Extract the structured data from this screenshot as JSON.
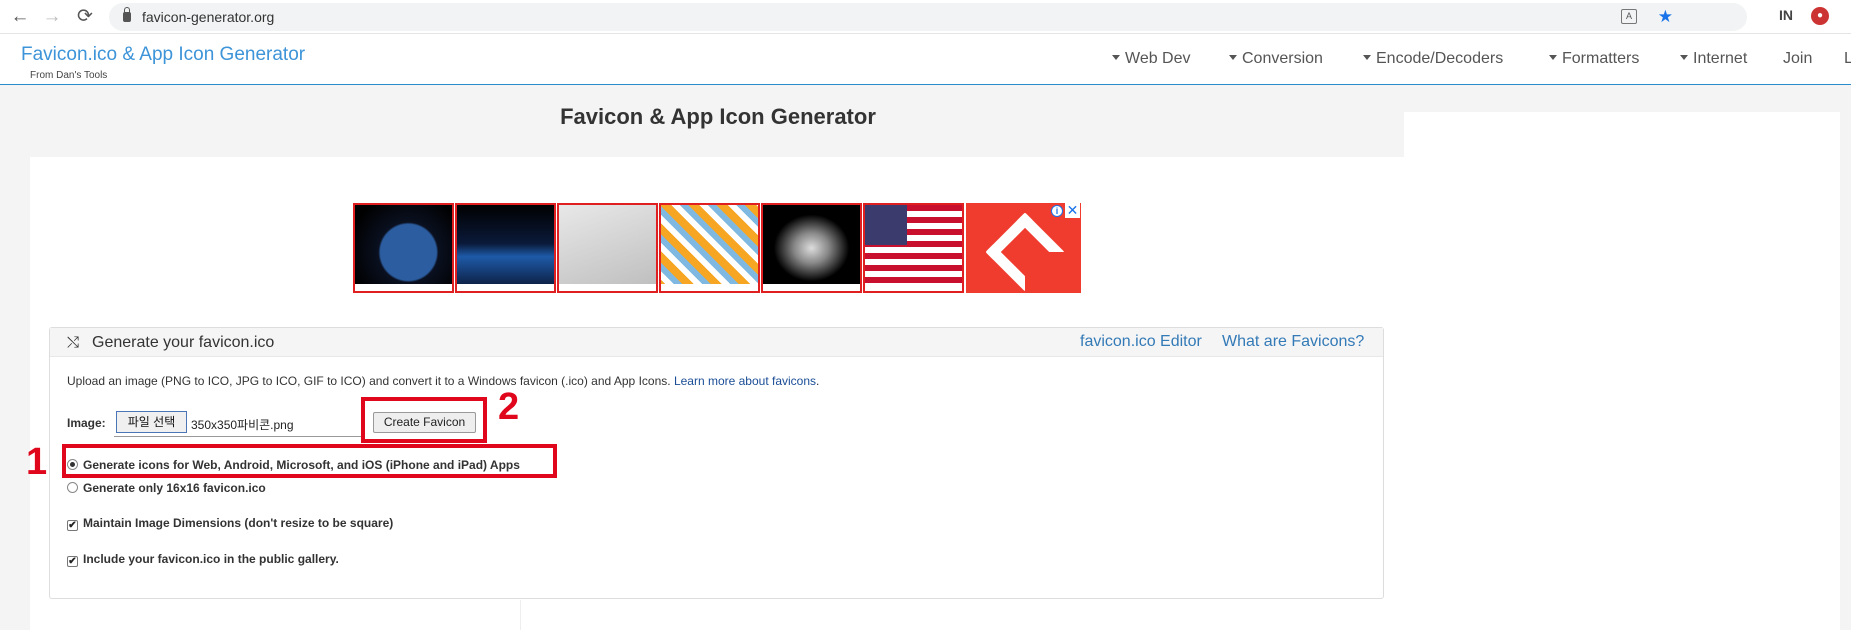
{
  "browser": {
    "url": "favicon-generator.org",
    "back_icon": "←",
    "forward_icon": "→",
    "reload_icon": "⟳",
    "star_icon": "★",
    "translate_icon": "A",
    "ext1_icon": "IN",
    "ext2_icon": "●"
  },
  "header": {
    "brand": "Favicon.ico & App Icon Generator",
    "brand_sub": "From Dan's Tools",
    "nav": [
      "Web Dev",
      "Conversion",
      "Encode/Decoders",
      "Formatters",
      "Internet",
      "Join",
      "L"
    ]
  },
  "page_title": "Favicon & App Icon Generator",
  "ad": {
    "info_icon": "i",
    "close_icon": "✕"
  },
  "panel": {
    "title": "Generate your favicon.ico",
    "shuffle_icon": "⤭",
    "links": [
      "favicon.ico Editor",
      "What are Favicons?"
    ],
    "description": "Upload an image (PNG to ICO, JPG to ICO, GIF to ICO) and convert it to a Windows favicon (.ico) and App Icons.",
    "learn_more": "Learn more about favicons",
    "description_end": ".",
    "image_label": "Image:",
    "file_button": "파일 선택",
    "file_name": "350x350파비콘.png",
    "create_button": "Create Favicon",
    "radio_options": [
      {
        "label": "Generate icons for Web, Android, Microsoft, and iOS (iPhone and iPad) Apps",
        "checked": true
      },
      {
        "label": "Generate only 16x16 favicon.ico",
        "checked": false
      }
    ],
    "checkbox_options": [
      {
        "label": "Maintain Image Dimensions (don't resize to be square)",
        "checked": true
      },
      {
        "label": "Include your favicon.ico in the public gallery.",
        "checked": true
      }
    ],
    "check_mark": "✔"
  },
  "annotations": [
    "1",
    "2"
  ],
  "colors": {
    "accent": "#337ab7",
    "annotation": "#e0061b",
    "brand": "#3d94d8"
  }
}
